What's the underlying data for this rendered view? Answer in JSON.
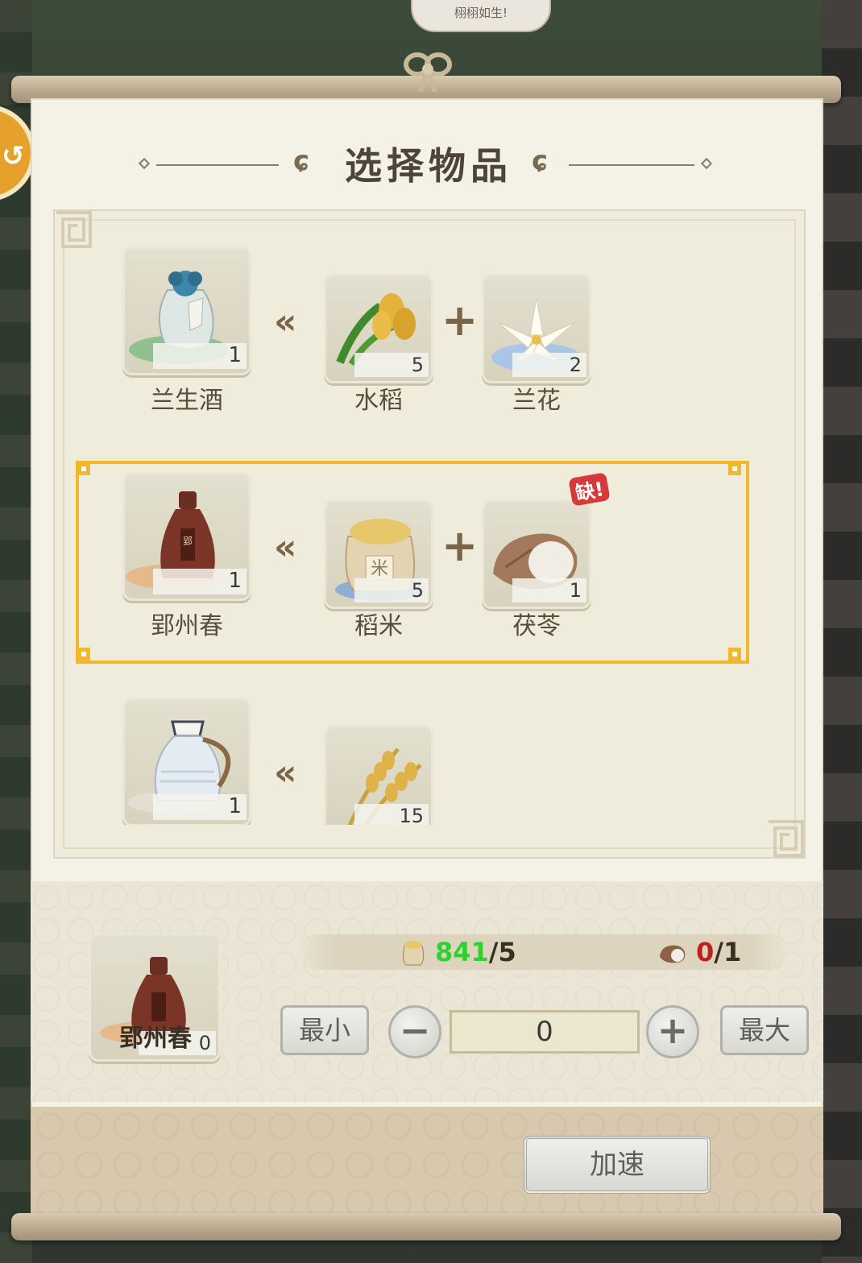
{
  "background": {
    "speech_text": "栩栩如生!"
  },
  "dialog": {
    "title": "选择物品",
    "recipes": [
      {
        "product": {
          "name": "兰生酒",
          "count": "1",
          "icon": "orchid-wine-bottle-icon"
        },
        "ingredients": [
          {
            "name": "水稻",
            "count": "5",
            "icon": "rice-plant-icon"
          },
          {
            "name": "兰花",
            "count": "2",
            "icon": "orchid-flower-icon"
          }
        ],
        "selected": false
      },
      {
        "product": {
          "name": "郢州春",
          "count": "1",
          "icon": "brown-wine-jar-icon"
        },
        "ingredients": [
          {
            "name": "稻米",
            "count": "5",
            "icon": "rice-sack-icon"
          },
          {
            "name": "茯苓",
            "count": "1",
            "icon": "poria-root-icon",
            "missing_badge": "缺!"
          }
        ],
        "selected": true
      },
      {
        "product": {
          "name": "",
          "count": "1",
          "icon": "white-wine-jug-icon"
        },
        "ingredients": [
          {
            "name": "",
            "count": "15",
            "icon": "wheat-ear-icon"
          }
        ],
        "selected": false
      }
    ],
    "current": {
      "name": "郢州春",
      "count": "0",
      "requirements": [
        {
          "icon": "rice-sack-icon",
          "have": "841",
          "need": "/5",
          "status": "ok"
        },
        {
          "icon": "poria-root-icon",
          "have": "0",
          "need": "/1",
          "status": "insufficient"
        }
      ]
    },
    "controls": {
      "min_label": "最小",
      "max_label": "最大",
      "decrement_icon": "minus-icon",
      "increment_icon": "plus-icon",
      "quantity": "0",
      "speed_up_label": "加速"
    },
    "colors": {
      "selected_border": "#f0b82a",
      "ok_text": "#2ed12f",
      "insufficient_text": "#c0201f",
      "missing_badge": "#d6393a"
    }
  }
}
